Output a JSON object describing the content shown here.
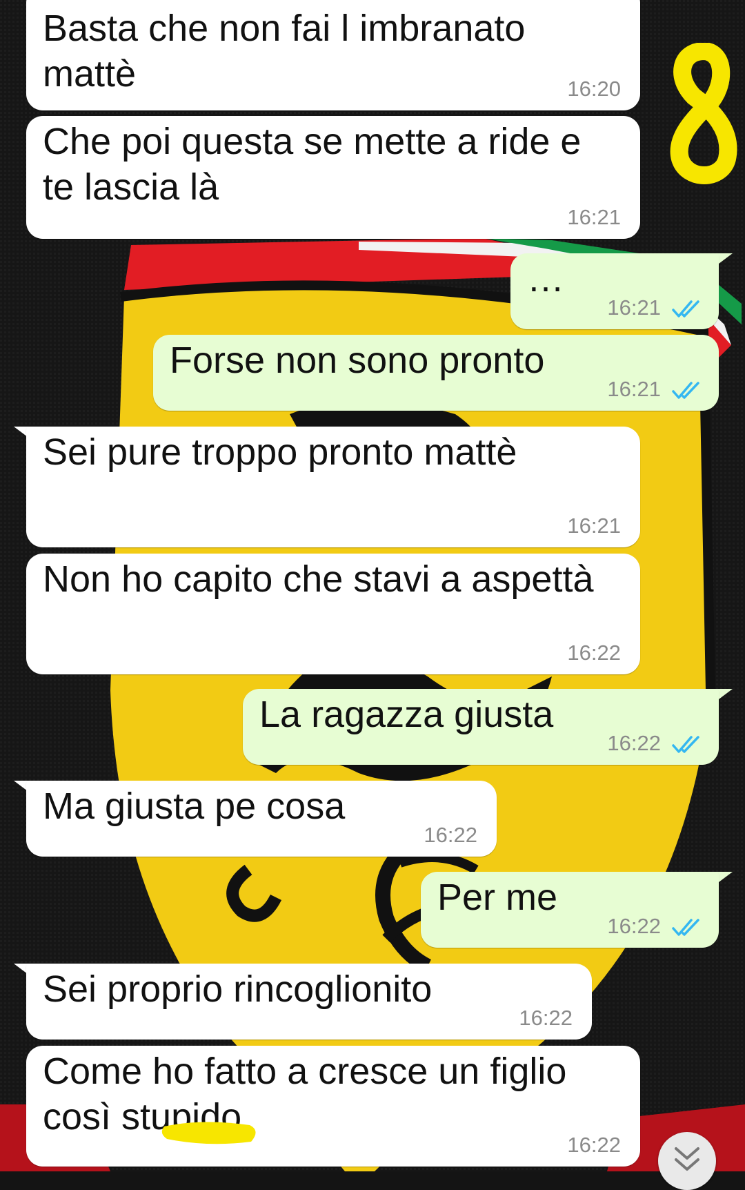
{
  "colors": {
    "incoming_bubble": "#ffffff",
    "outgoing_bubble": "#e7fdd3",
    "read_ticks": "#34b7f1",
    "time_text": "#8a8a8a",
    "annotation_yellow": "#f7e600"
  },
  "wallpaper": {
    "description_icon": "ferrari-shield-wallpaper"
  },
  "annotation": {
    "number": "8"
  },
  "messages": [
    {
      "direction": "in",
      "text": "Basta che non fai l imbranato\nmattè",
      "time": "16:20"
    },
    {
      "direction": "in",
      "text": "Che poi questa se mette a ride e\nte lascia là",
      "time": "16:21"
    },
    {
      "direction": "out",
      "text": "…",
      "time": "16:21",
      "status": "read"
    },
    {
      "direction": "out",
      "text": "Forse non sono pronto",
      "time": "16:21",
      "status": "read"
    },
    {
      "direction": "in",
      "text": "Sei pure troppo pronto mattè",
      "time": "16:21"
    },
    {
      "direction": "in",
      "text": "Non ho capito che stavi a aspettà",
      "time": "16:22"
    },
    {
      "direction": "out",
      "text": "La ragazza giusta",
      "time": "16:22",
      "status": "read"
    },
    {
      "direction": "in",
      "text": "Ma giusta pe cosa",
      "time": "16:22"
    },
    {
      "direction": "out",
      "text": "Per me",
      "time": "16:22",
      "status": "read"
    },
    {
      "direction": "in",
      "text": "Sei proprio rincoglionito",
      "time": "16:22"
    },
    {
      "direction": "in",
      "text": "Come ho fatto a cresce un figlio\ncosì stupido",
      "time": "16:22"
    }
  ],
  "scroll_button": {
    "icon": "chevron-double-down-icon"
  }
}
